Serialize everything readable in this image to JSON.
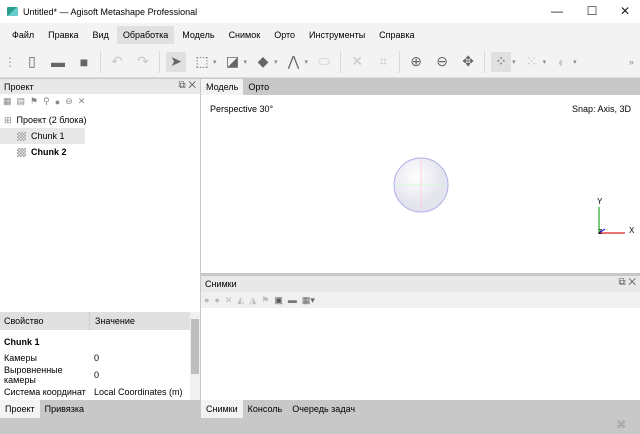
{
  "window": {
    "title": "Untitled* — Agisoft Metashape Professional",
    "minimize": "—",
    "maximize": "☐",
    "close": "✕"
  },
  "menu": [
    "Файл",
    "Правка",
    "Вид",
    "Обработка",
    "Модель",
    "Снимок",
    "Орто",
    "Инструменты",
    "Справка"
  ],
  "menu_active": "Обработка",
  "toolbar": {
    "overflow": "»"
  },
  "project_panel": {
    "title": "Проект",
    "tree": {
      "root": "Проект (2 блока)",
      "chunks": [
        "Chunk 1",
        "Chunk 2"
      ]
    }
  },
  "properties": {
    "columns": [
      "Свойство",
      "Значение"
    ],
    "section": "Chunk 1",
    "rows": [
      {
        "k": "Камеры",
        "v": "0"
      },
      {
        "k": "Выровненные камеры",
        "v": "0"
      },
      {
        "k": "Система координат",
        "v": "Local Coordinates (m)"
      }
    ]
  },
  "left_tabs": [
    "Проект",
    "Привязка"
  ],
  "viewport": {
    "tabs": [
      "Модель",
      "Орто"
    ],
    "projection": "Perspective 30°",
    "snap": "Snap: Axis, 3D",
    "axes": {
      "x": "X",
      "y": "Y",
      "z": "Z"
    }
  },
  "photos_panel": {
    "title": "Снимки"
  },
  "bottom_tabs": [
    "Снимки",
    "Консоль",
    "Очередь задач"
  ]
}
